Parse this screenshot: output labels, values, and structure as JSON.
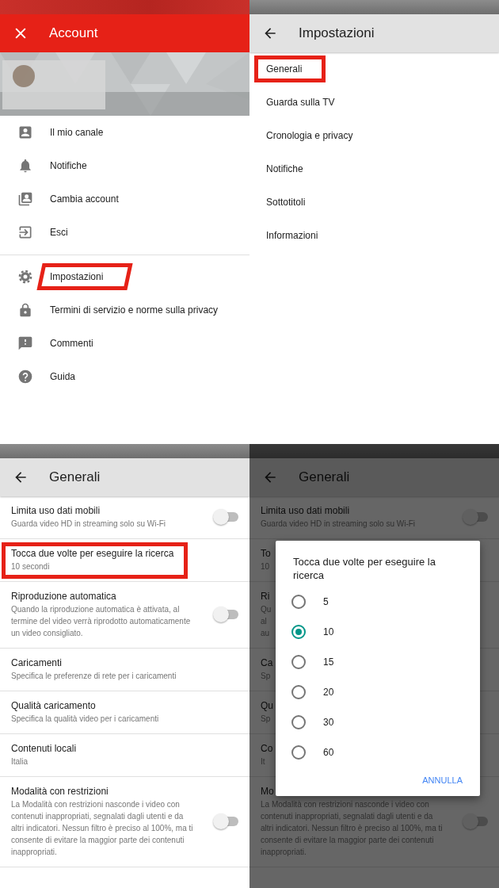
{
  "account_drawer": {
    "title": "Account",
    "menu_groups": [
      [
        {
          "label": "Il mio canale",
          "annotated": false
        },
        {
          "label": "Notifiche",
          "annotated": false
        },
        {
          "label": "Cambia account",
          "annotated": false
        },
        {
          "label": "Esci",
          "annotated": false
        }
      ],
      [
        {
          "label": "Impostazioni",
          "annotated": true
        },
        {
          "label": "Termini di servizio e norme sulla privacy",
          "annotated": false
        },
        {
          "label": "Commenti",
          "annotated": false
        },
        {
          "label": "Guida",
          "annotated": false
        }
      ]
    ]
  },
  "settings_screen": {
    "title": "Impostazioni",
    "items": [
      {
        "label": "Generali",
        "annotated": true
      },
      {
        "label": "Guarda sulla TV",
        "annotated": false
      },
      {
        "label": "Cronologia e privacy",
        "annotated": false
      },
      {
        "label": "Notifiche",
        "annotated": false
      },
      {
        "label": "Sottotitoli",
        "annotated": false
      },
      {
        "label": "Informazioni",
        "annotated": false
      }
    ]
  },
  "general_screen": {
    "title": "Generali",
    "rows": [
      {
        "title": "Limita uso dati mobili",
        "subtitle": "Guarda video HD in streaming solo su Wi-Fi",
        "toggle": {
          "on": false
        },
        "annotated": false
      },
      {
        "title": "Tocca due volte per eseguire la ricerca",
        "subtitle": "10 secondi",
        "annotated": true
      },
      {
        "title": "Riproduzione automatica",
        "subtitle": "Quando la riproduzione automatica è attivata, al termine del video verrà riprodotto automaticamente un video consigliato.",
        "toggle": {
          "on": false
        },
        "annotated": false
      },
      {
        "title": "Caricamenti",
        "subtitle": "Specifica le preferenze di rete per i caricamenti",
        "annotated": false
      },
      {
        "title": "Qualità caricamento",
        "subtitle": "Specifica la qualità video per i caricamenti",
        "annotated": false
      },
      {
        "title": "Contenuti locali",
        "subtitle": "Italia",
        "annotated": false
      },
      {
        "title": "Modalità con restrizioni",
        "subtitle": "La Modalità con restrizioni nasconde i video con contenuti inappropriati, segnalati dagli utenti e da altri indicatori. Nessun filtro è preciso al 100%, ma ti consente di evitare la maggior parte dei contenuti inappropriati.",
        "toggle": {
          "on": false
        },
        "annotated": false
      }
    ]
  },
  "dialog_screen": {
    "title": "Generali",
    "background_rows": [
      {
        "title": "Limita uso dati mobili",
        "subtitle": "Guarda video HD in streaming solo su Wi-Fi",
        "toggle": {
          "on": false
        }
      },
      {
        "title": "To",
        "subtitle": "10"
      },
      {
        "title": "Ri",
        "subtitle": "Qu\nal\nau"
      },
      {
        "title": "Ca",
        "subtitle": "Sp"
      },
      {
        "title": "Qu",
        "subtitle": "Sp"
      },
      {
        "title": "Co",
        "subtitle": "It"
      },
      {
        "title": "Mo",
        "subtitle": "La Modalità con restrizioni nasconde i video con contenuti inappropriati, segnalati dagli utenti e da altri indicatori. Nessun filtro è preciso al 100%, ma ti consente di evitare la maggior parte dei contenuti inappropriati.",
        "toggle": {
          "on": false
        }
      }
    ],
    "dialog": {
      "title": "Tocca due volte per eseguire la ricerca",
      "options": [
        {
          "label": "5",
          "selected": false
        },
        {
          "label": "10",
          "selected": true
        },
        {
          "label": "15",
          "selected": false
        },
        {
          "label": "20",
          "selected": false
        },
        {
          "label": "30",
          "selected": false
        },
        {
          "label": "60",
          "selected": false
        }
      ],
      "cancel": "ANNULLA"
    }
  }
}
